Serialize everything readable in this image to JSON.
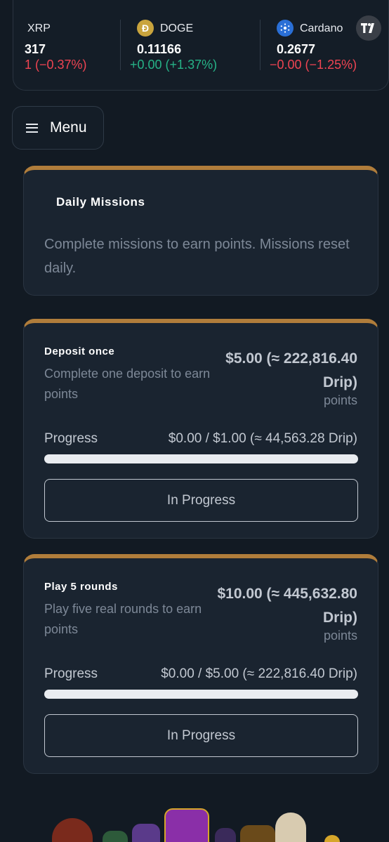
{
  "ticker": [
    {
      "name": "XRP",
      "price": "317",
      "change": "1 (−0.37%)",
      "direction": "down",
      "icon": ""
    },
    {
      "name": "DOGE",
      "price": "0.11166",
      "change": "+0.00 (+1.37%)",
      "direction": "up",
      "icon": "doge-coin-icon"
    },
    {
      "name": "Cardano",
      "price": "0.2677",
      "change": "−0.00 (−1.25%)",
      "direction": "down",
      "icon": "cardano-coin-icon"
    }
  ],
  "menu": {
    "label": "Menu"
  },
  "daily": {
    "title": "Daily Missions",
    "description": "Complete missions to earn points. Missions reset daily."
  },
  "missions": [
    {
      "title": "Deposit once",
      "description": "Complete one deposit to earn points",
      "reward": "$5.00 (≈ 222,816.40 Drip)",
      "reward_unit": "points",
      "progress_label": "Progress",
      "progress_value": "$0.00 / $1.00 (≈ 44,563.28 Drip)",
      "progress_fraction": 0,
      "status": "In Progress"
    },
    {
      "title": "Play 5 rounds",
      "description": "Play five real rounds to earn points",
      "reward": "$10.00 (≈ 445,632.80 Drip)",
      "reward_unit": "points",
      "progress_label": "Progress",
      "progress_value": "$0.00 / $5.00 (≈ 222,816.40 Drip)",
      "progress_fraction": 0,
      "status": "In Progress"
    }
  ],
  "colors": {
    "accent": "#b07d3b",
    "positive": "#26b387",
    "negative": "#ef4452",
    "background": "#121a23",
    "card": "#1a2430"
  }
}
